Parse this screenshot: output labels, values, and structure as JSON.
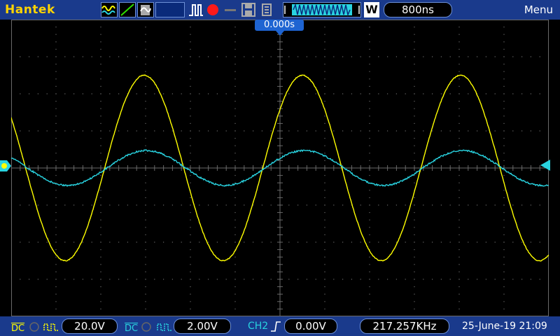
{
  "header": {
    "brand": "Hantek",
    "timebase": "800ns",
    "trigger_mode_letter": "W",
    "menu_label": "Menu",
    "trigger_time": "0.000s"
  },
  "colors": {
    "ch1": "#ffff00",
    "ch2": "#29d3e0",
    "bar_bg": "#1a3a8c",
    "grid": "#6a6a6a"
  },
  "footer": {
    "ch1": {
      "coupling": "DC",
      "scale": "20.0V"
    },
    "ch2": {
      "coupling": "DC",
      "scale": "2.00V"
    },
    "trigger": {
      "source": "CH2",
      "level": "0.00V"
    },
    "frequency": "217.257KHz",
    "datetime": "25-June-19 21:09"
  },
  "waveforms": [
    {
      "channel": "CH1",
      "shape": "sine",
      "cycles_on_screen": 3.4,
      "amplitude_divisions": 2.5
    },
    {
      "channel": "CH2",
      "shape": "sine",
      "cycles_on_screen": 3.4,
      "amplitude_divisions": 0.47
    }
  ]
}
